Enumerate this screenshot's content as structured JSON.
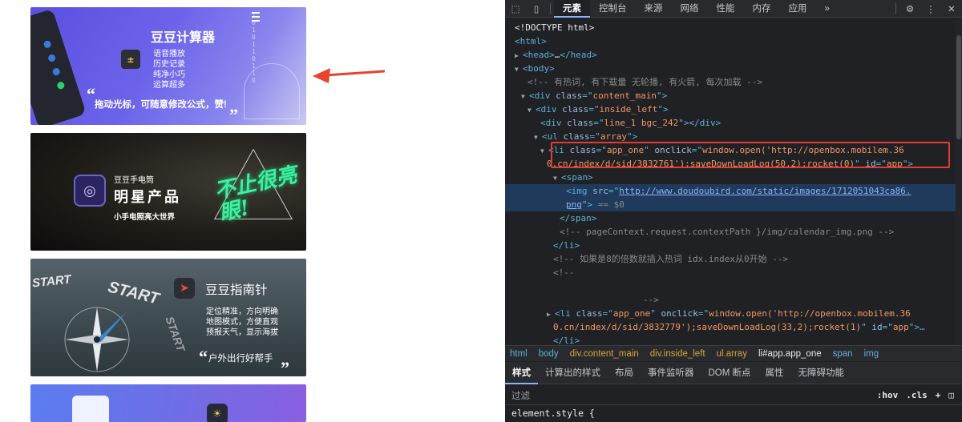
{
  "left_page": {
    "banner1": {
      "title": "豆豆计算器",
      "features": [
        "语音播放",
        "历史记录",
        "纯净小巧",
        "运算超多"
      ],
      "binary_column": "1010110110",
      "slogan": "拖动光标，可随意修改公式，赞!",
      "icon": "calculator-icon"
    },
    "banner2": {
      "brand": "豆豆手电筒",
      "title": "明星产品",
      "subtitle": "小手电照亮大世界",
      "neon_text": "不止很亮眼!",
      "icon": "flashlight-icon"
    },
    "banner3": {
      "title": "豆豆指南针",
      "features": [
        "定位精准，方向明确",
        "地图模式，方便直观",
        "预报天气，显示海拔"
      ],
      "slogan": "户外出行好帮手",
      "start_texts": [
        "START",
        "START",
        "START"
      ],
      "icon": "compass-icon"
    },
    "banner4": {
      "icon": "weather-icon"
    },
    "arrow_color": "#e8432f"
  },
  "devtools": {
    "tabs": [
      "元素",
      "控制台",
      "来源",
      "网络",
      "性能",
      "内存",
      "应用",
      "»"
    ],
    "active_tab": "元素",
    "dom_lines": [
      {
        "indent": 0,
        "arrow": "",
        "parts": [
          [
            "plain",
            "<!DOCTYPE html>"
          ]
        ]
      },
      {
        "indent": 0,
        "arrow": "",
        "parts": [
          [
            "tag",
            "<html>"
          ]
        ]
      },
      {
        "indent": 0,
        "arrow": "▶",
        "parts": [
          [
            "tag",
            "<head>"
          ],
          [
            "plain",
            "…"
          ],
          [
            "tag",
            "</head>"
          ]
        ]
      },
      {
        "indent": 0,
        "arrow": "▼",
        "parts": [
          [
            "tag",
            "<body>"
          ]
        ]
      },
      {
        "indent": 2,
        "arrow": "",
        "parts": [
          [
            "cmt",
            "<!-- 有热词, 有下载量  无轮播, 有火箭, 每次加载 -->"
          ]
        ]
      },
      {
        "indent": 1,
        "arrow": "▼",
        "parts": [
          [
            "tag",
            "<div "
          ],
          [
            "attr",
            "class"
          ],
          [
            "tag",
            "=\""
          ],
          [
            "val",
            "content_main"
          ],
          [
            "tag",
            "\">"
          ]
        ]
      },
      {
        "indent": 2,
        "arrow": "▼",
        "parts": [
          [
            "tag",
            "<div "
          ],
          [
            "attr",
            "class"
          ],
          [
            "tag",
            "=\""
          ],
          [
            "val",
            "inside_left"
          ],
          [
            "tag",
            "\">"
          ]
        ]
      },
      {
        "indent": 4,
        "arrow": "",
        "parts": [
          [
            "tag",
            "<div "
          ],
          [
            "attr",
            "class"
          ],
          [
            "tag",
            "=\""
          ],
          [
            "val",
            "line_1 bgc_242"
          ],
          [
            "tag",
            "\"></div>"
          ]
        ]
      },
      {
        "indent": 3,
        "arrow": "▼",
        "parts": [
          [
            "tag",
            "<ul "
          ],
          [
            "attr",
            "class"
          ],
          [
            "tag",
            "=\""
          ],
          [
            "val",
            "array"
          ],
          [
            "tag",
            "\">"
          ]
        ]
      },
      {
        "indent": 4,
        "arrow": "▼",
        "parts": [
          [
            "tag",
            "<li "
          ],
          [
            "attr",
            "class"
          ],
          [
            "tag",
            "=\""
          ],
          [
            "val",
            "app_one"
          ],
          [
            "tag",
            "\" "
          ],
          [
            "attr",
            "onclick"
          ],
          [
            "tag",
            "=\""
          ],
          [
            "val",
            "window.open('http://openbox.mobilem.36"
          ]
        ]
      },
      {
        "indent": 5,
        "arrow": "",
        "parts": [
          [
            "val",
            "0.cn/index/d/sid/3832761');saveDownLoadLog(50,2);rocket(0)"
          ],
          [
            "tag",
            "\" "
          ],
          [
            "attr",
            "id"
          ],
          [
            "tag",
            "=\""
          ],
          [
            "val",
            "app"
          ],
          [
            "tag",
            "\">"
          ]
        ]
      },
      {
        "indent": 6,
        "arrow": "▼",
        "parts": [
          [
            "tag",
            "<span>"
          ]
        ]
      },
      {
        "indent": 8,
        "arrow": "",
        "selected": true,
        "parts": [
          [
            "tag",
            "<img "
          ],
          [
            "attr",
            "src"
          ],
          [
            "tag",
            "=\""
          ],
          [
            "link",
            "http://www.doudoubird.com/static/images/1712051043ca86."
          ]
        ]
      },
      {
        "indent": 8,
        "arrow": "",
        "selected": true,
        "parts": [
          [
            "link",
            "png"
          ],
          [
            "tag",
            "\">"
          ],
          [
            "cmt",
            " == $0"
          ]
        ]
      },
      {
        "indent": 7,
        "arrow": "",
        "parts": [
          [
            "tag",
            "</span>"
          ]
        ]
      },
      {
        "indent": 7,
        "arrow": "",
        "parts": [
          [
            "cmt",
            "<!-- pageContext.request.contextPath }/img/calendar_img.png -->"
          ]
        ]
      },
      {
        "indent": 6,
        "arrow": "",
        "parts": [
          [
            "tag",
            "</li>"
          ]
        ]
      },
      {
        "indent": 6,
        "arrow": "",
        "parts": [
          [
            "cmt",
            "<!-- 如果是8的倍数就插入热词    idx.index从0开始 -->"
          ]
        ]
      },
      {
        "indent": 6,
        "arrow": "",
        "parts": [
          [
            "cmt",
            "<!--"
          ]
        ]
      },
      {
        "indent": 6,
        "arrow": "",
        "parts": [
          [
            "cmt",
            ""
          ]
        ]
      },
      {
        "indent": 20,
        "arrow": "",
        "parts": [
          [
            "cmt",
            "-->"
          ]
        ]
      },
      {
        "indent": 5,
        "arrow": "▶",
        "parts": [
          [
            "tag",
            "<li "
          ],
          [
            "attr",
            "class"
          ],
          [
            "tag",
            "=\""
          ],
          [
            "val",
            "app_one"
          ],
          [
            "tag",
            "\" "
          ],
          [
            "attr",
            "onclick"
          ],
          [
            "tag",
            "=\""
          ],
          [
            "val",
            "window.open('http://openbox.mobilem.36"
          ]
        ]
      },
      {
        "indent": 6,
        "arrow": "",
        "parts": [
          [
            "val",
            "0.cn/index/d/sid/3832779');saveDownLoadLog(33,2);rocket(1)"
          ],
          [
            "tag",
            "\" "
          ],
          [
            "attr",
            "id"
          ],
          [
            "tag",
            "=\""
          ],
          [
            "val",
            "app"
          ],
          [
            "tag",
            "\">…"
          ]
        ]
      },
      {
        "indent": 6,
        "arrow": "",
        "parts": [
          [
            "tag",
            "</li>"
          ]
        ]
      },
      {
        "indent": 6,
        "arrow": "",
        "parts": [
          [
            "cmt",
            "<!-- 如果是8的倍数就插入热词    idx.index从0开始 -->"
          ]
        ]
      }
    ],
    "breadcrumbs": [
      {
        "kind": "tag",
        "text": "html"
      },
      {
        "kind": "tag",
        "text": "body"
      },
      {
        "kind": "cls",
        "text": "div.content_main"
      },
      {
        "kind": "cls",
        "text": "div.inside_left"
      },
      {
        "kind": "cls",
        "text": "ul.array"
      },
      {
        "kind": "plain",
        "text": "li#app.app_one"
      },
      {
        "kind": "tag",
        "text": "span"
      },
      {
        "kind": "tag",
        "text": "img"
      }
    ],
    "sub_tabs": [
      "样式",
      "计算出的样式",
      "布局",
      "事件监听器",
      "DOM 断点",
      "属性",
      "无障碍功能"
    ],
    "active_sub_tab": "样式",
    "filter_placeholder": "过滤",
    "filter_hov": ":hov",
    "filter_cls": ".cls",
    "filter_plus": "+",
    "style_rule": "element.style {",
    "colors": {
      "highlight_box": "#e43d30",
      "selected_row": "#1f3a5a",
      "panel_bg": "#202124"
    }
  }
}
